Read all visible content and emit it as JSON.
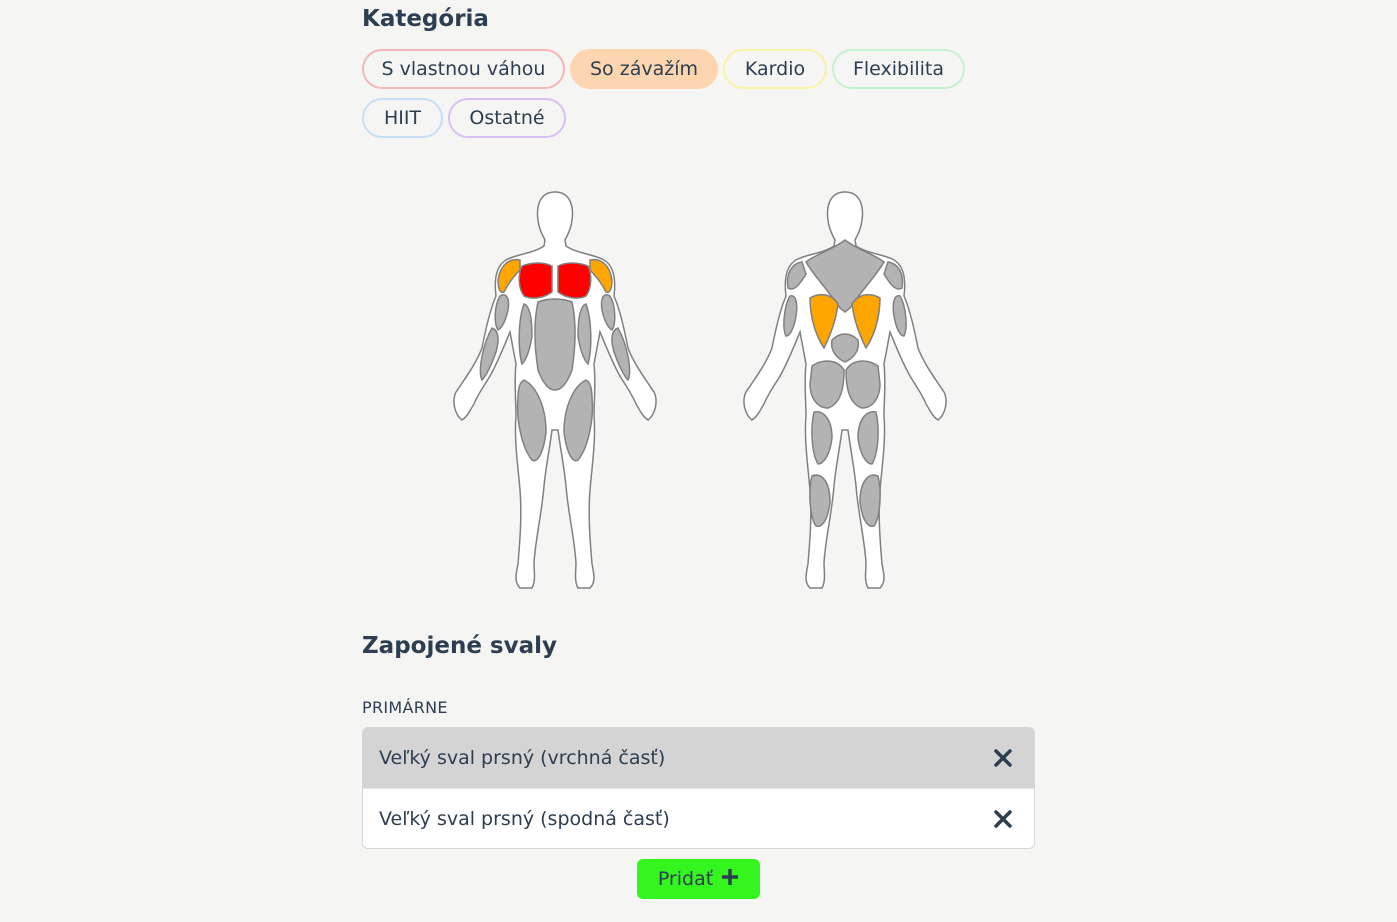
{
  "category": {
    "title": "Kategória",
    "chips": [
      {
        "label": "S vlastnou váhou",
        "selected": false,
        "color": "#f4b6b6"
      },
      {
        "label": "So závažím",
        "selected": true,
        "color": "#fdd5b0"
      },
      {
        "label": "Kardio",
        "selected": false,
        "color": "#f9f3a6"
      },
      {
        "label": "Flexibilita",
        "selected": false,
        "color": "#c6f1cf"
      },
      {
        "label": "HIIT",
        "selected": false,
        "color": "#c4e0f6"
      },
      {
        "label": "Ostatné",
        "selected": false,
        "color": "#d9c0f4"
      }
    ]
  },
  "body_map": {
    "front_highlights": {
      "chest": "#ff0000",
      "shoulders": "#ffa500"
    },
    "back_highlights": {
      "lats": "#ffa500"
    },
    "inactive_color": "#b3b3b3"
  },
  "muscles": {
    "title": "Zapojené svaly",
    "primary_label": "PRIMÁRNE",
    "items": [
      {
        "name": "Veľký sval prsný (vrchná časť)",
        "active": true
      },
      {
        "name": "Veľký sval prsný (spodná časť)",
        "active": false
      }
    ],
    "remove_icon": "close-icon"
  },
  "actions": {
    "add_label": "Pridať",
    "add_icon": "plus-icon",
    "add_color": "#35f51e"
  }
}
